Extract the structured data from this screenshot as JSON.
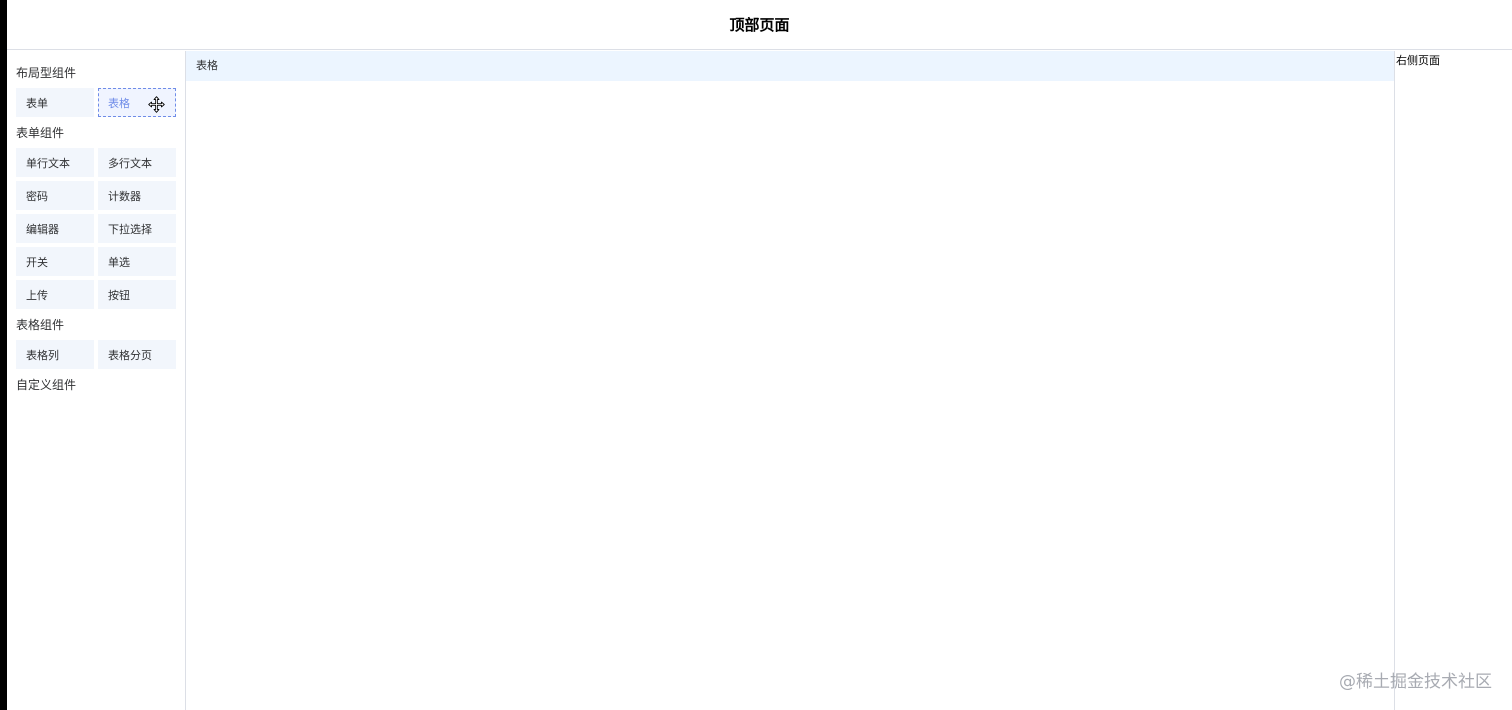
{
  "header": {
    "title": "顶部页面"
  },
  "sidebar": {
    "groups": [
      {
        "title": "布局型组件",
        "items": [
          "表单",
          "表格"
        ]
      },
      {
        "title": "表单组件",
        "items": [
          "单行文本",
          "多行文本",
          "密码",
          "计数器",
          "编辑器",
          "下拉选择",
          "开关",
          "单选",
          "上传",
          "按钮"
        ]
      },
      {
        "title": "表格组件",
        "items": [
          "表格列",
          "表格分页"
        ]
      },
      {
        "title": "自定义组件",
        "items": []
      }
    ]
  },
  "canvas": {
    "items": [
      "表格"
    ]
  },
  "right_panel": {
    "title": "右侧页面"
  },
  "watermark": {
    "text": "@稀土掘金技术社区"
  },
  "colors": {
    "item_bg": "#f2f6fc",
    "canvas_item_bg": "#ecf5ff",
    "drag_border": "#6f8ce8"
  },
  "icons": {
    "drag_cursor": "move-cursor-icon"
  }
}
